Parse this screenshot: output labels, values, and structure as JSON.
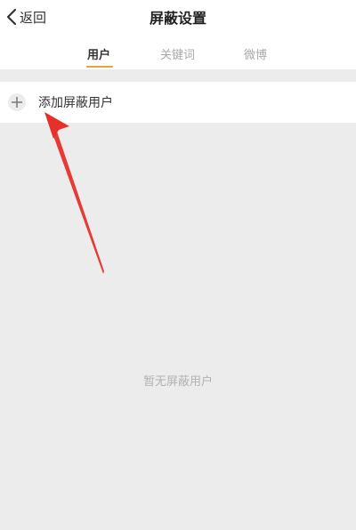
{
  "navbar": {
    "back_label": "返回",
    "title": "屏蔽设置"
  },
  "tabs": [
    {
      "label": "用户",
      "active": true
    },
    {
      "label": "关键词",
      "active": false
    },
    {
      "label": "微博",
      "active": false
    }
  ],
  "add_row": {
    "icon": "plus-icon",
    "label": "添加屏蔽用户"
  },
  "empty_state": "暂无屏蔽用户",
  "colors": {
    "accent": "#f0a030",
    "arrow": "#e8302a",
    "background": "#ececec"
  }
}
